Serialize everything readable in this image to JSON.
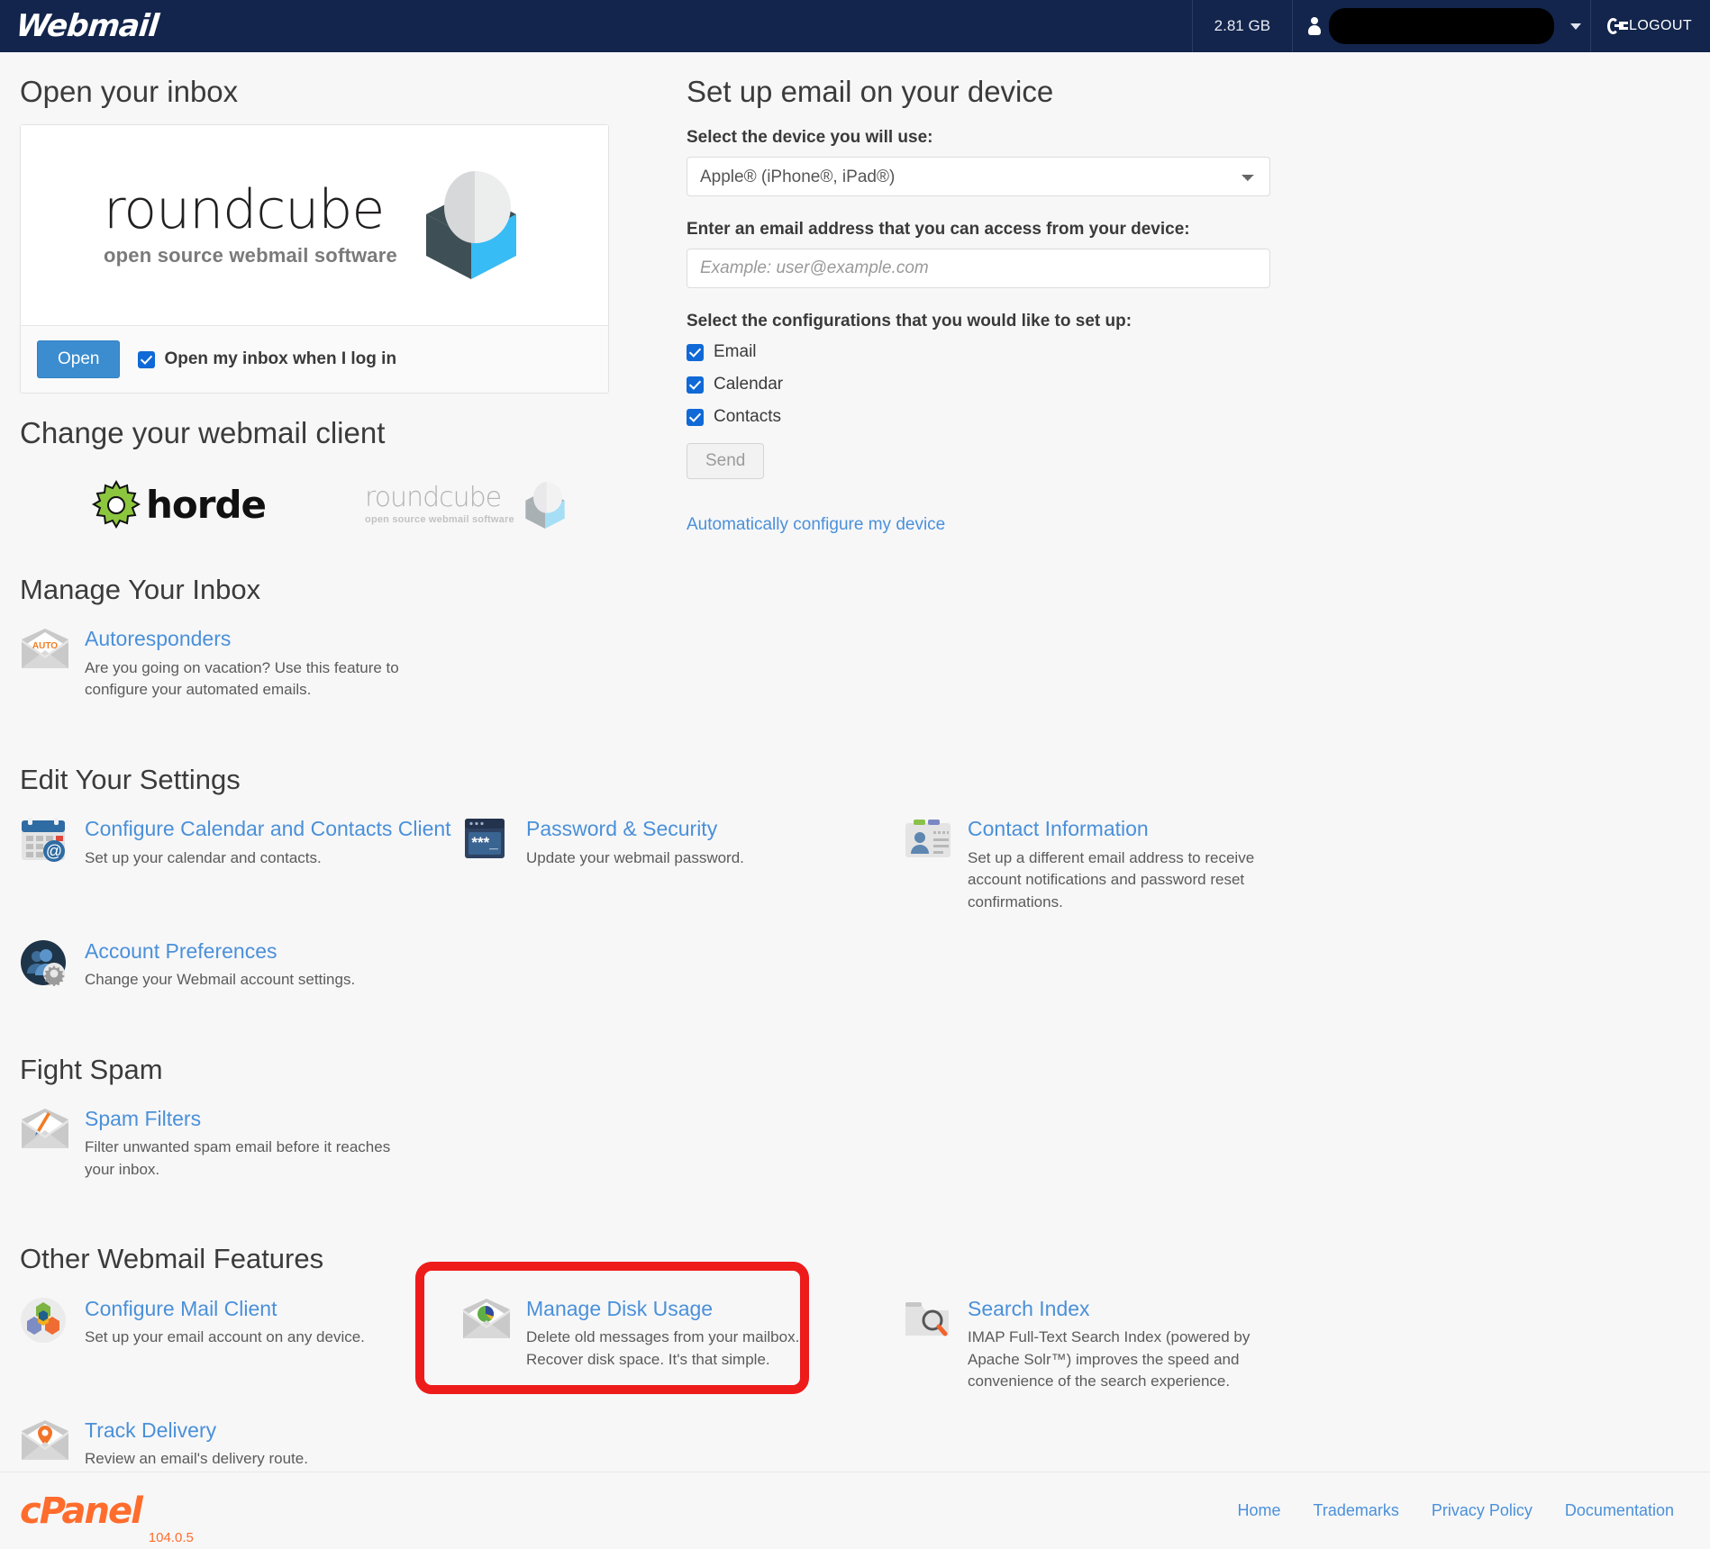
{
  "header": {
    "brand": "Webmail",
    "quota": "2.81 GB",
    "user_redacted": "",
    "logout_label": "LOGOUT"
  },
  "inbox": {
    "heading": "Open your inbox",
    "logo_word": "roundcube",
    "logo_tagline": "open source webmail software",
    "open_button": "Open",
    "open_on_login_label": "Open my inbox when I log in",
    "open_on_login_checked": true
  },
  "change_client": {
    "heading": "Change your webmail client",
    "options": [
      {
        "name": "horde",
        "label": "horde",
        "active": true
      },
      {
        "name": "roundcube",
        "label": "roundcube",
        "tagline": "open source webmail software",
        "active": false
      }
    ]
  },
  "setup": {
    "heading": "Set up email on your device",
    "device_label": "Select the device you will use:",
    "device_selected": "Apple® (iPhone®, iPad®)",
    "device_options": [
      "Apple® (iPhone®, iPad®)"
    ],
    "email_label": "Enter an email address that you can access from your device:",
    "email_value": "",
    "email_placeholder": "Example: user@example.com",
    "config_label": "Select the configurations that you would like to set up:",
    "configs": [
      {
        "label": "Email",
        "checked": true
      },
      {
        "label": "Calendar",
        "checked": true
      },
      {
        "label": "Contacts",
        "checked": true
      }
    ],
    "send_button": "Send",
    "auto_configure_link": "Automatically configure my device"
  },
  "sections": [
    {
      "heading": "Manage Your Inbox",
      "tiles": [
        {
          "icon": "envelope-auto-icon",
          "title": "Autoresponders",
          "desc": "Are you going on vacation? Use this feature to configure your automated emails."
        }
      ]
    },
    {
      "heading": "Edit Your Settings",
      "tiles": [
        {
          "icon": "calendar-at-icon",
          "title": "Configure Calendar and Contacts Client",
          "desc": "Set up your calendar and contacts."
        },
        {
          "icon": "password-window-icon",
          "title": "Password & Security",
          "desc": "Update your webmail password."
        },
        {
          "icon": "contact-card-icon",
          "title": "Contact Information",
          "desc": "Set up a different email address to receive account notifications and password reset confirmations."
        },
        {
          "icon": "users-gear-icon",
          "title": "Account Preferences",
          "desc": "Change your Webmail account settings."
        }
      ]
    },
    {
      "heading": "Fight Spam",
      "tiles": [
        {
          "icon": "envelope-feather-icon",
          "title": "Spam Filters",
          "desc": "Filter unwanted spam email before it reaches your inbox."
        }
      ]
    },
    {
      "heading": "Other Webmail Features",
      "tiles": [
        {
          "icon": "hex-cluster-icon",
          "title": "Configure Mail Client",
          "desc": "Set up your email account on any device."
        },
        {
          "icon": "envelope-piechart-icon",
          "title": "Manage Disk Usage",
          "desc": "Delete old messages from your mailbox. Recover disk space. It's that simple.",
          "highlighted": true
        },
        {
          "icon": "folder-search-icon",
          "title": "Search Index",
          "desc": "IMAP Full-Text Search Index (powered by Apache Solr™) improves the speed and convenience of the search experience."
        },
        {
          "icon": "envelope-pin-icon",
          "title": "Track Delivery",
          "desc": "Review an email's delivery route."
        }
      ]
    }
  ],
  "footer": {
    "logo": "cPanel",
    "version": "104.0.5",
    "links": [
      "Home",
      "Trademarks",
      "Privacy Policy",
      "Documentation"
    ]
  },
  "colors": {
    "header_bg": "#13254c",
    "link_blue": "#4a90d9",
    "button_blue": "#3b8dd0",
    "highlight_red": "#ee1b1b",
    "cpanel_orange": "#ff6c2c"
  }
}
